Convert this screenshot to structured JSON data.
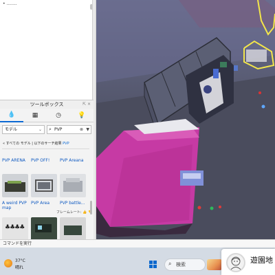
{
  "output_panel": {
    "text": "• ........"
  },
  "toolbox": {
    "title": "ツールボックス",
    "title_buttons": "⇱ ×",
    "tabs": [
      {
        "icon": "drop-icon",
        "glyph": "💧"
      },
      {
        "icon": "grid-icon",
        "glyph": "▦"
      },
      {
        "icon": "clock-icon",
        "glyph": "◷"
      },
      {
        "icon": "bulb-icon",
        "glyph": "💡"
      }
    ],
    "category_select": "モデル",
    "search_value": "PVP",
    "breadcrumb_prefix": "« すべての モデル | 以下のサーチ結果",
    "breadcrumb_query": "PVP",
    "row1_labels": [
      "PVP ARENA",
      "PVP OFF!",
      "PVP Areana"
    ],
    "row2_labels": [
      "A weird PVP map",
      "PVP Area",
      "PVP battle..."
    ],
    "tooltip": "フレームレート: 👍 👎"
  },
  "command_bar": {
    "placeholder": "コマンドを実行"
  },
  "taskbar": {
    "weather_temp": "37°C",
    "weather_desc": "晴れ",
    "search_label": "検索"
  },
  "notification": {
    "text": "遊園地"
  },
  "colors": {
    "accent": "#0b69d3",
    "magenta": "#c4399d",
    "neon": "#f3e64a"
  }
}
